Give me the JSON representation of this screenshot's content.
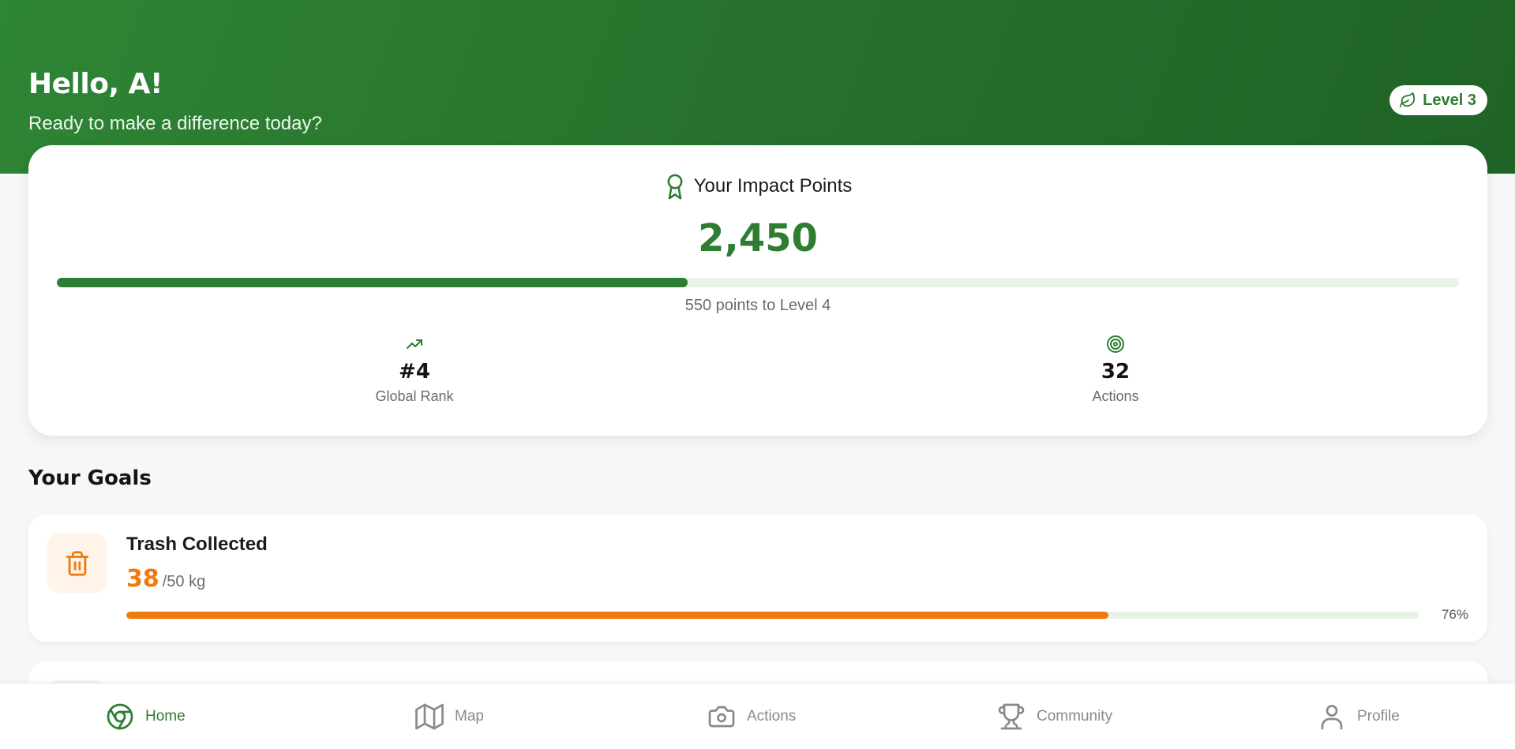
{
  "header": {
    "greeting": "Hello, A!",
    "subtitle": "Ready to make a difference today?",
    "level_badge": "Level 3",
    "level_icon": "leaf-icon",
    "background_color": "#2e7d32"
  },
  "impact": {
    "title": "Your Impact Points",
    "title_icon": "award-icon",
    "points": "2,450",
    "progress_percent": 45,
    "caption": "550 points to Level 4",
    "stats": [
      {
        "icon": "trending-up-icon",
        "value": "#4",
        "label": "Global Rank"
      },
      {
        "icon": "target-icon",
        "value": "32",
        "label": "Actions"
      }
    ],
    "accent_color": "#2d7d32"
  },
  "goals": {
    "section_title": "Your Goals",
    "items": [
      {
        "icon": "trash-icon",
        "title": "Trash Collected",
        "current": "38",
        "target": "/50 kg",
        "progress_percent": 76,
        "percent_label": "76%",
        "color": "#f07a0c"
      }
    ]
  },
  "nav": {
    "items": [
      {
        "label": "Home",
        "icon": "home-icon",
        "active": true
      },
      {
        "label": "Map",
        "icon": "map-icon",
        "active": false
      },
      {
        "label": "Actions",
        "icon": "camera-icon",
        "active": false
      },
      {
        "label": "Community",
        "icon": "trophy-icon",
        "active": false
      },
      {
        "label": "Profile",
        "icon": "user-icon",
        "active": false
      }
    ]
  }
}
